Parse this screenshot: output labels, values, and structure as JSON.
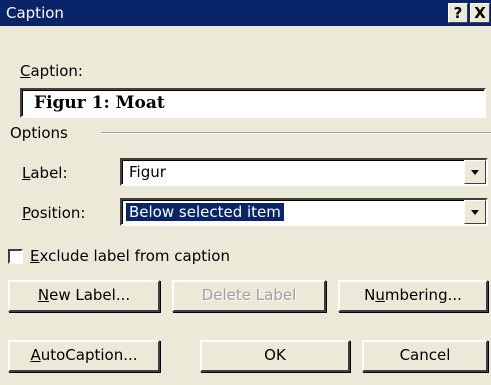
{
  "window": {
    "title": "Caption",
    "help_label": "?",
    "close_label": "X"
  },
  "caption": {
    "label_accel": "C",
    "label_rest": "aption:",
    "value": "Figur 1: Moat"
  },
  "options": {
    "group_label": "Options",
    "label_field": {
      "label_accel": "L",
      "label_rest": "abel:",
      "value": "Figur"
    },
    "position_field": {
      "label_accel": "P",
      "label_rest": "osition:",
      "value": "Below selected item"
    }
  },
  "exclude_checkbox": {
    "label_accel": "E",
    "label_rest": "xclude label from caption",
    "checked": false
  },
  "buttons": {
    "new_label": {
      "accel": "N",
      "rest": "ew Label..."
    },
    "delete_label": "Delete Label",
    "numbering": {
      "pre": "N",
      "accel": "u",
      "rest": "mbering..."
    },
    "autocaption": {
      "accel": "A",
      "rest": "utoCaption..."
    },
    "ok": "OK",
    "cancel": "Cancel"
  },
  "colors": {
    "titlebar": "#0a246a",
    "dialog_bg": "#ece9d8",
    "selection": "#0a246a"
  }
}
